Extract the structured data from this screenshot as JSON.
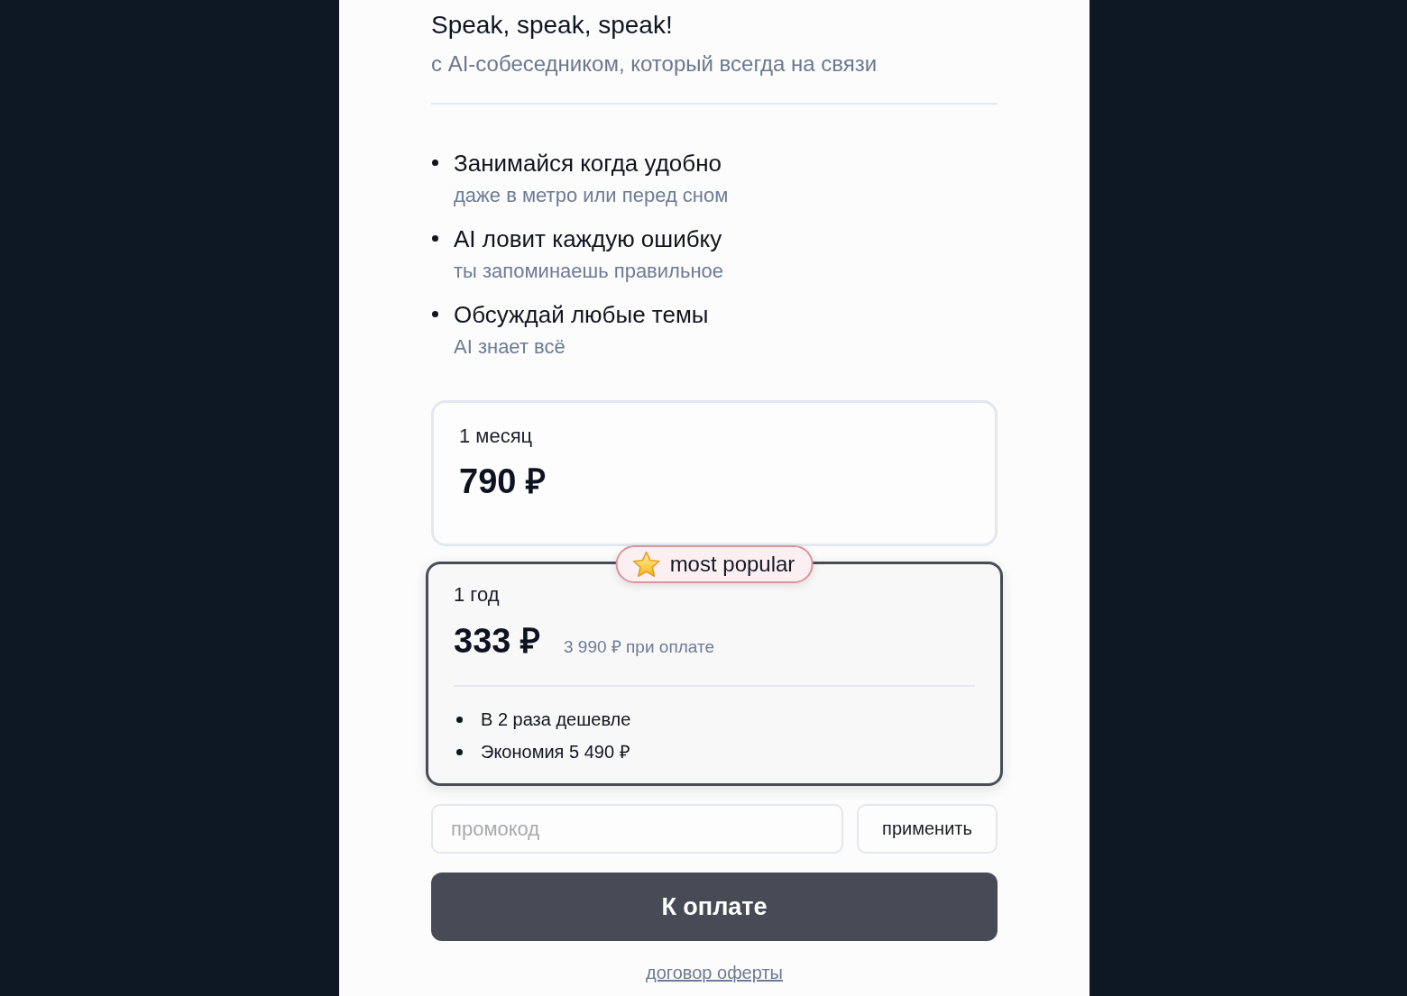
{
  "header": {
    "title": "Speak, speak, speak!",
    "subtitle": "с AI-собеседником, который всегда на связи"
  },
  "features": [
    {
      "title": "Занимайся когда удобно",
      "subtitle": "даже в метро или перед сном"
    },
    {
      "title": "AI ловит каждую ошибку",
      "subtitle": "ты запоминаешь правильное"
    },
    {
      "title": "Обсуждай любые темы",
      "subtitle": "AI знает всё"
    }
  ],
  "plans": [
    {
      "period": "1 месяц",
      "price": "790 ₽",
      "selected": false
    },
    {
      "period": "1 год",
      "price": "333 ₽",
      "note": "3 990 ₽ при оплате",
      "badge": "most popular",
      "perks": [
        "В 2 раза дешевле",
        "Экономия 5 490 ₽"
      ],
      "selected": true
    }
  ],
  "promo": {
    "placeholder": "промокод",
    "button": "применить"
  },
  "pay_button": "К оплате",
  "offer_link": "договор оферты"
}
